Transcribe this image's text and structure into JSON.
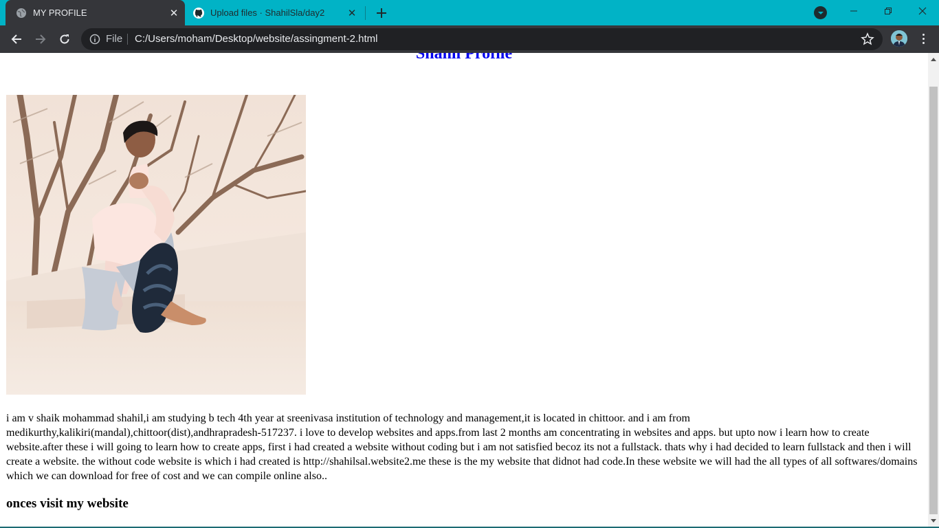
{
  "browser": {
    "tabs": [
      {
        "title": "MY PROFILE",
        "active": true,
        "icon": "globe-icon"
      },
      {
        "title": "Upload files · ShahilSla/day2",
        "active": false,
        "icon": "github-icon"
      }
    ],
    "address_bar": {
      "scheme_label": "File",
      "url": "C:/Users/moham/Desktop/website/assingment-2.html"
    },
    "colors": {
      "tab_strip": "#01b3c6",
      "toolbar": "#35363a",
      "omnibox": "#202124"
    }
  },
  "page": {
    "title": "Shahil Profile",
    "title_color": "#0000ee",
    "bio": "i am v shaik mohammad shahil,i am studying b tech 4th year at sreenivasa institution of technology and management,it is located in chittoor. and i am from medikurthy,kalikiri(mandal),chittoor(dist),andhrapradesh-517237. i love to develop websites and apps.from last 2 months am concentrating in websites and apps. but upto now i learn how to create website.after these i will going to learn how to create apps, first i had created a website without coding but i am not satisfied becoz its not a fullstack. thats why i had decided to learn fullstack and then i will create a website. the without code website is which i had created is http://shahilsal.website2.me these is the my website that didnot had code.In these website we will had the all types of all softwares/domains which we can download for free of cost and we can compile online also..",
    "visit_heading": "onces visit my website"
  }
}
